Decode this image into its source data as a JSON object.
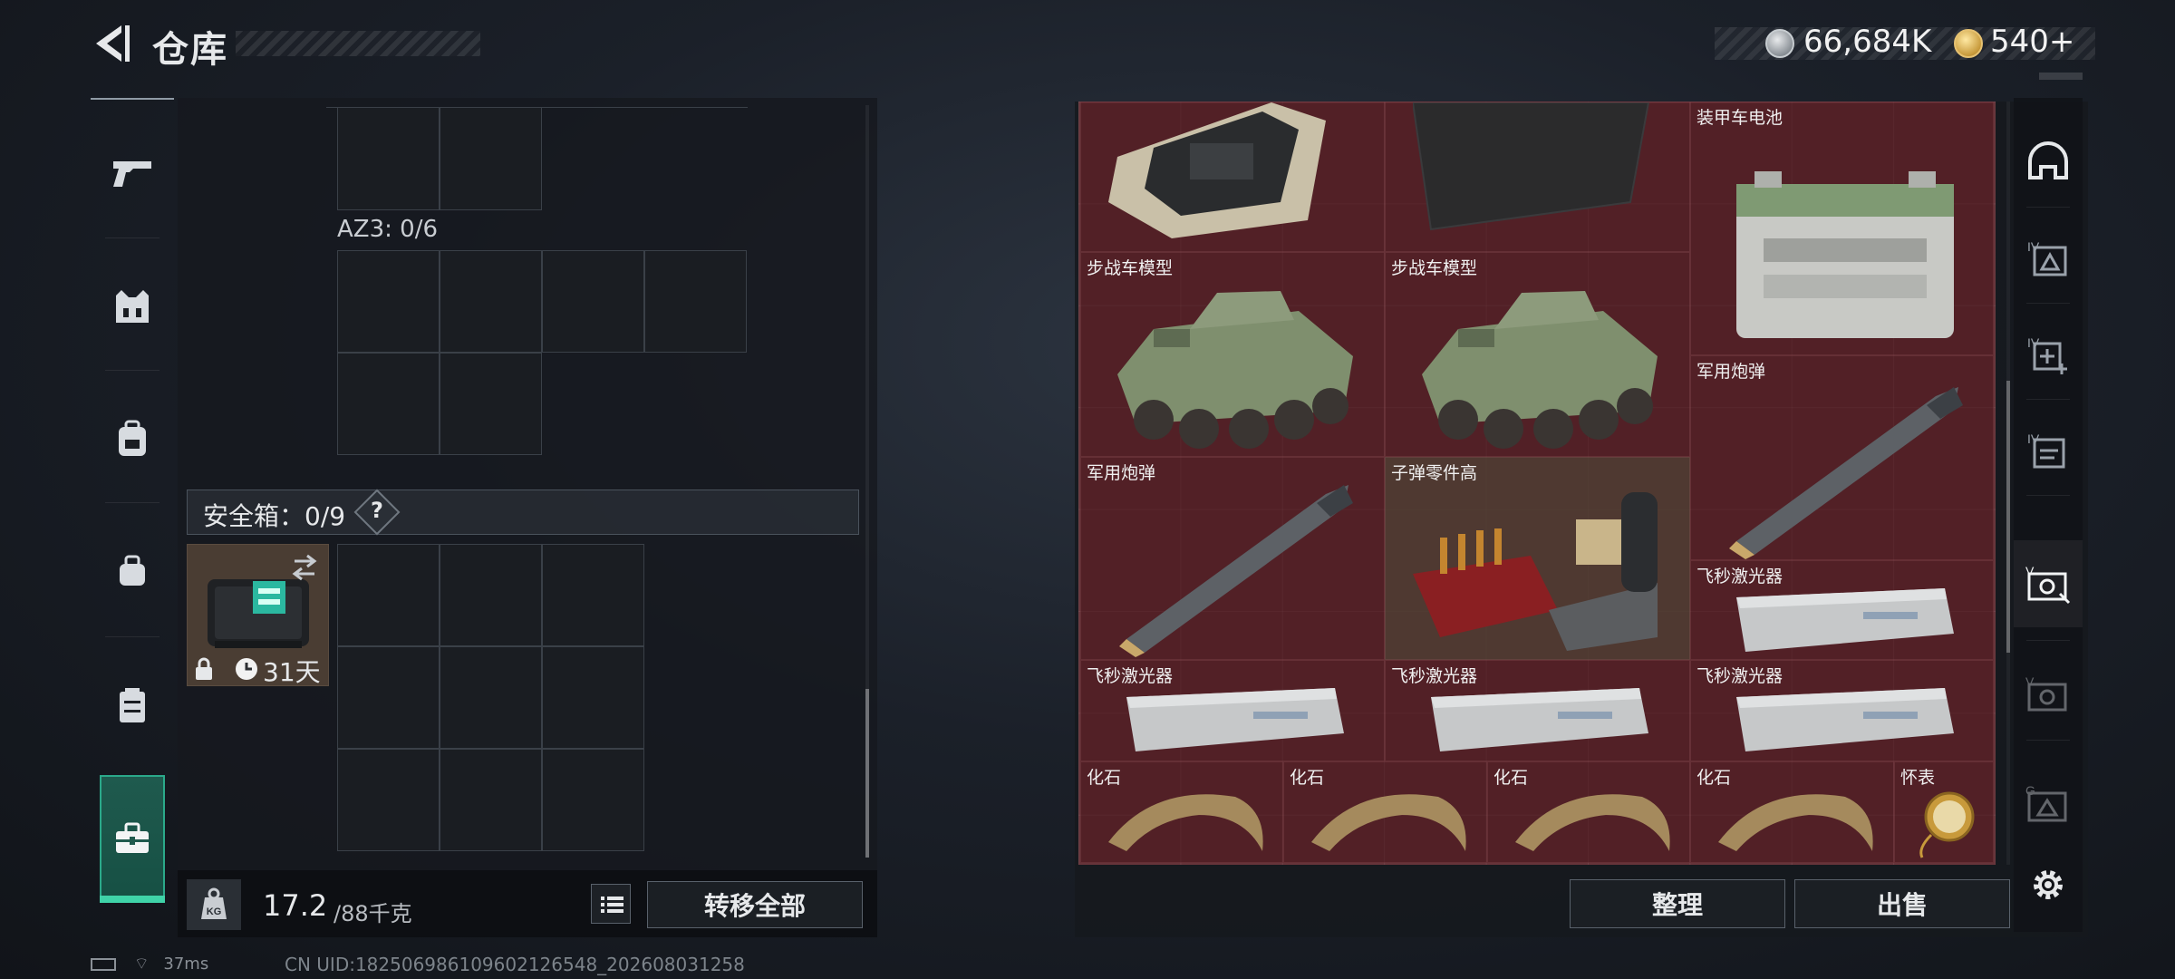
{
  "header": {
    "title": "仓库"
  },
  "currency": [
    {
      "icon": "silver-coin-icon",
      "value": "66,684K"
    },
    {
      "icon": "gold-coin-icon",
      "value": "540+"
    }
  ],
  "left_nav": [
    "pistol-icon",
    "vest-icon",
    "backpack-icon",
    "small-bag-icon",
    "chest-rig-icon",
    "toolbox-icon"
  ],
  "left_panel": {
    "az3_label": "AZ3: 0/6",
    "safebox_label": "安全箱：0/9",
    "safebox_help": "?",
    "safebox_days": "31天",
    "weight_current": "17.2",
    "weight_max": "/88千克",
    "kg_icon_text": "KG",
    "transfer_all": "转移全部"
  },
  "right_panel": {
    "items": [
      {
        "label": "",
        "kind": "circuit-board"
      },
      {
        "label": "",
        "kind": "carbon-plate"
      },
      {
        "label": "装甲车电池",
        "kind": "battery"
      },
      {
        "label": "步战车模型",
        "kind": "ifv"
      },
      {
        "label": "步战车模型",
        "kind": "ifv"
      },
      {
        "label": "军用炮弹",
        "kind": "shell"
      },
      {
        "label": "军用炮弹",
        "kind": "shell"
      },
      {
        "label": "子弹零件高",
        "kind": "ammo-parts"
      },
      {
        "label": "飞秒激光器",
        "kind": "laser"
      },
      {
        "label": "飞秒激光器",
        "kind": "laser"
      },
      {
        "label": "飞秒激光器",
        "kind": "laser"
      },
      {
        "label": "飞秒激光器",
        "kind": "laser"
      },
      {
        "label": "化石",
        "kind": "fossil"
      },
      {
        "label": "化石",
        "kind": "fossil"
      },
      {
        "label": "化石",
        "kind": "fossil"
      },
      {
        "label": "化石",
        "kind": "fossil"
      },
      {
        "label": "怀表",
        "kind": "pocket-watch"
      }
    ],
    "sort_label": "整理",
    "sell_label": "出售"
  },
  "right_nav": [
    "helmet-icon",
    "iv-armor-icon",
    "iv-medical-icon",
    "iv-file-icon",
    "v-safebox-icon",
    "v-safebox-dim-icon",
    "g-case-icon",
    "settings-icon"
  ],
  "status": {
    "ping": "37ms",
    "uid": "CN UID:18250698610960212654​8_202608031258"
  },
  "colors": {
    "accent_green": "#3fd3a8",
    "item_bg": "#4a2024"
  }
}
